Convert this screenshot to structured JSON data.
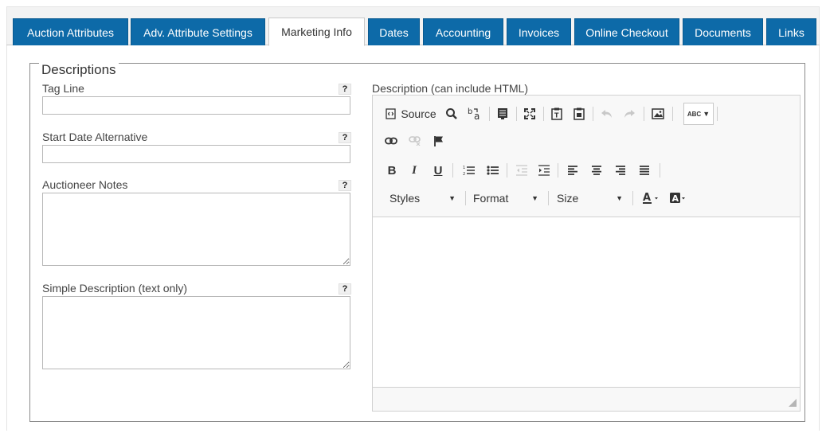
{
  "tabs": [
    {
      "label": "Auction Attributes",
      "active": false
    },
    {
      "label": "Adv. Attribute Settings",
      "active": false
    },
    {
      "label": "Marketing Info",
      "active": true
    },
    {
      "label": "Dates",
      "active": false
    },
    {
      "label": "Accounting",
      "active": false
    },
    {
      "label": "Invoices",
      "active": false
    },
    {
      "label": "Online Checkout",
      "active": false
    },
    {
      "label": "Documents",
      "active": false
    },
    {
      "label": "Links",
      "active": false
    }
  ],
  "fieldset": {
    "legend": "Descriptions"
  },
  "fields": {
    "tag_line": {
      "label": "Tag Line",
      "help": "?",
      "value": ""
    },
    "start_date_alt": {
      "label": "Start Date Alternative",
      "help": "?",
      "value": ""
    },
    "auctioneer_notes": {
      "label": "Auctioneer Notes",
      "help": "?",
      "value": ""
    },
    "simple_description": {
      "label": "Simple Description (text only)",
      "help": "?",
      "value": ""
    }
  },
  "editor": {
    "label": "Description (can include HTML)",
    "source_label": "Source",
    "styles_label": "Styles",
    "format_label": "Format",
    "size_label": "Size",
    "bold": "B",
    "italic": "I",
    "underline": "U",
    "spell_label": "ABC"
  },
  "colors": {
    "tab_blue": "#0d6aa8",
    "tab_border": "#0a5a90"
  }
}
